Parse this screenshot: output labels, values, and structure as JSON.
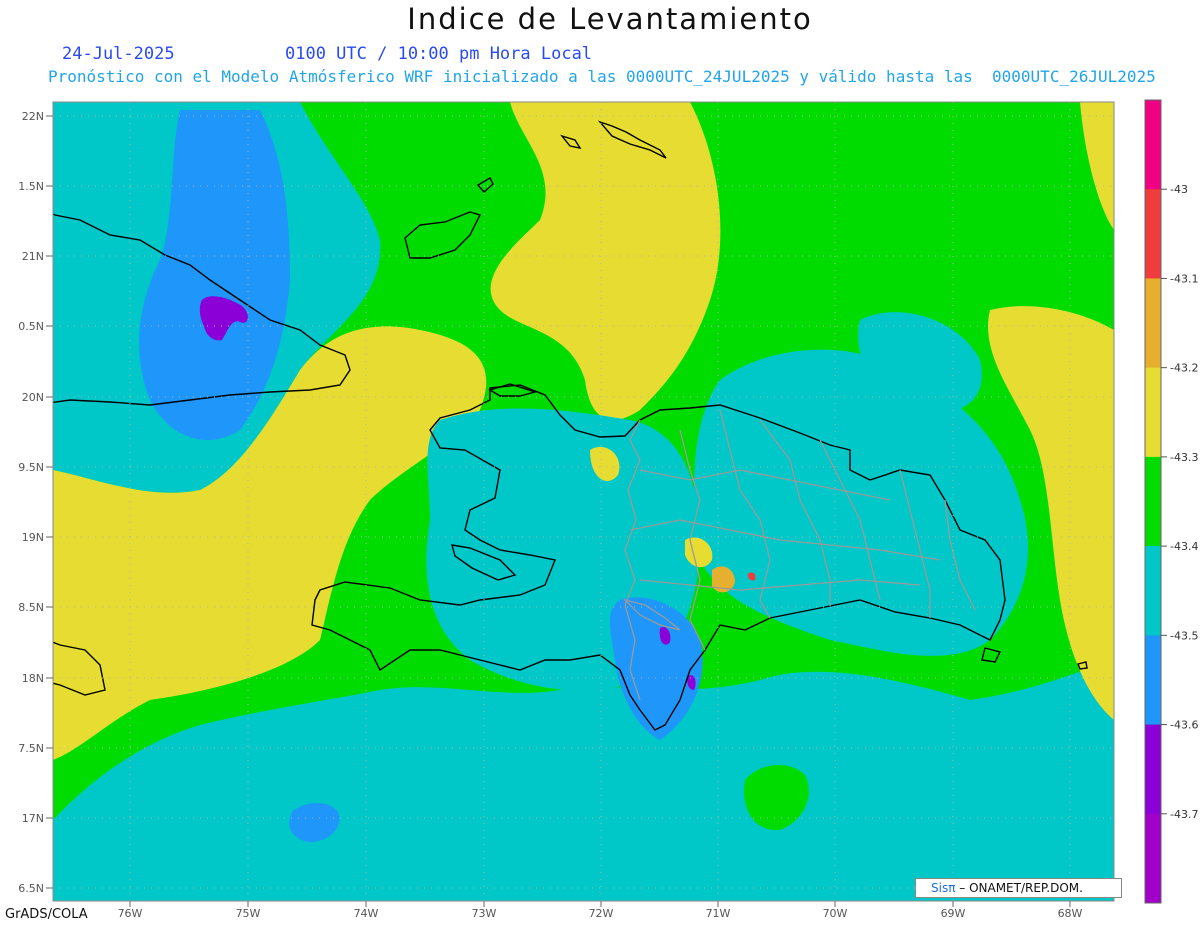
{
  "header": {
    "title": "Indice de Levantamiento",
    "date": "24-Jul-2025",
    "time": "0100 UTC / 10:00 pm Hora Local",
    "description": "Pronóstico con el Modelo Atmósferico WRF inicializado a las 0000UTC_24JUL2025 y válido hasta las  0000UTC_26JUL2025"
  },
  "map": {
    "lat_labels": [
      "22N",
      "1.5N",
      "21N",
      "0.5N",
      "20N",
      "9.5N",
      "19N",
      "8.5N",
      "18N",
      "7.5N",
      "17N",
      "6.5N"
    ],
    "lon_labels": [
      "76W",
      "75W",
      "74W",
      "73W",
      "72W",
      "71W",
      "70W",
      "69W",
      "68W"
    ],
    "field_colors": {
      "purple": "#8a00d6",
      "blue": "#1e96fa",
      "cyan": "#00c8c8",
      "green": "#00dc00",
      "yellow": "#e6dc32",
      "orange": "#e6af2d",
      "red": "#f03c3c",
      "magenta": "#f00082"
    }
  },
  "colorbar": {
    "colors": [
      "#f00082",
      "#f03c3c",
      "#e6af2d",
      "#e6dc32",
      "#00dc00",
      "#00c8c8",
      "#1e96fa",
      "#8a00d6",
      "#a000c8"
    ],
    "labels": [
      "-43",
      "-43.1",
      "-43.2",
      "-43.3",
      "-43.4",
      "-43.5",
      "-43.6",
      "-43.7"
    ]
  },
  "credit": {
    "sis": "Sisπ",
    "org": " – ONAMET/REP.DOM."
  },
  "footer": {
    "software": "GrADS/COLA"
  }
}
